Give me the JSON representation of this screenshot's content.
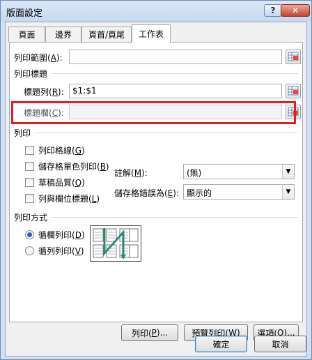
{
  "window": {
    "title": "版面設定"
  },
  "titlebar": {
    "help": "?",
    "close": "✕"
  },
  "tabs": [
    {
      "label": "頁面"
    },
    {
      "label": "邊界"
    },
    {
      "label": "頁首/頁尾"
    },
    {
      "label": "工作表"
    }
  ],
  "print_area": {
    "label": "列印範圍(",
    "key": "A",
    "suffix": "):",
    "value": ""
  },
  "print_titles": {
    "heading": "列印標題",
    "rows": {
      "label": "標題列(",
      "key": "R",
      "suffix": "):",
      "value": "$1:$1"
    },
    "cols": {
      "label": "標題欄(",
      "key": "C",
      "suffix": "):",
      "value": ""
    }
  },
  "print": {
    "heading": "列印",
    "gridlines": {
      "label": "列印格線(",
      "key": "G",
      "suffix": ")"
    },
    "black_white": {
      "label": "儲存格單色列印(",
      "key": "B",
      "suffix": ")"
    },
    "draft": {
      "label": "草稿品質(",
      "key": "Q",
      "suffix": ")"
    },
    "headings": {
      "label": "列與欄位標題(",
      "key": "L",
      "suffix": ")"
    },
    "comments": {
      "label": "註解(",
      "key": "M",
      "suffix": "):",
      "value": "(無)"
    },
    "errors": {
      "label": "儲存格錯誤為(",
      "key": "E",
      "suffix": "):",
      "value": "顯示的"
    }
  },
  "page_order": {
    "heading": "列印方式",
    "down_then_over": {
      "label": "循欄列印(",
      "key": "D",
      "suffix": ")",
      "selected": true
    },
    "over_then_down": {
      "label": "循列列印(",
      "key": "V",
      "suffix": ")",
      "selected": false
    }
  },
  "buttons": {
    "print": {
      "label": "列印(",
      "key": "P",
      "suffix": ")..."
    },
    "preview": {
      "label": "預覽列印(",
      "key": "W",
      "suffix": ")"
    },
    "options": {
      "label": "選項(",
      "key": "O",
      "suffix": ")..."
    },
    "ok": "確定",
    "cancel": "取消"
  },
  "colors": {
    "highlight": "#e02020",
    "page_order_arrow": "#2a8a7a"
  }
}
